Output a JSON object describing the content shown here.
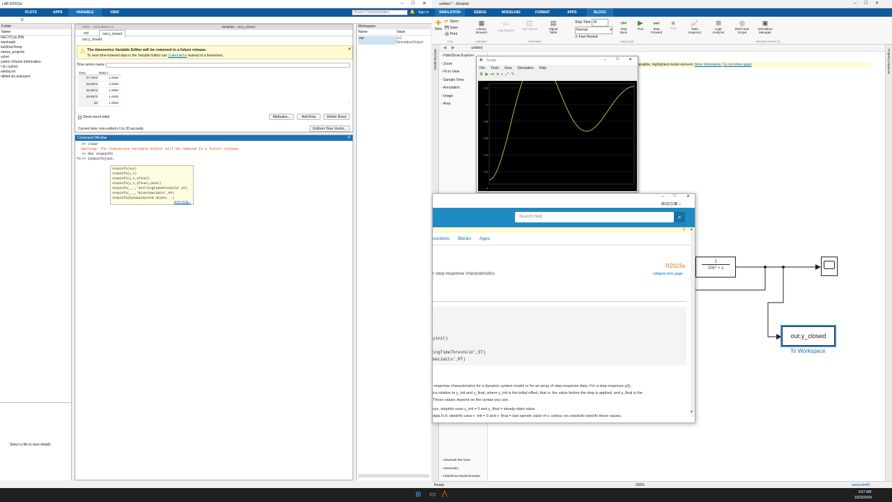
{
  "matlab": {
    "title": "LAB R2023a",
    "tabs": [
      "PLOTS",
      "APPS",
      "VARIABLE",
      "VIEW"
    ],
    "search_placeholder": "Search Documentation",
    "signin": "Sign In",
    "path": "D:",
    "folder_header": "Folder",
    "folder_col": "Name",
    "folder_items": [
      "RECYCLE.BIN",
      "ownloads",
      "ineDriveTemp",
      "eartus_projects",
      "ocket",
      "ystem Volume Information",
      "l (in cache)",
      "esktop.ini",
      "ntitled.slx.autosave"
    ],
    "details_text": "Select a file to view details",
    "editor_tab": "Editor - sdcaulfdetm.m",
    "variables_tab": "Variables - out.y_closed",
    "var_subtabs": [
      "out",
      "out.y_closed"
    ],
    "var_name": "out.y_closed",
    "warning_title": "The timeseries Variable Editor will be removed in a future release.",
    "warning_body_pre": "To view time-indexed data in the Variable Editor use",
    "warning_link": "timetable",
    "warning_body_post": "instead of a timeseries.",
    "ts_name_label": "Time series name:",
    "table_headers": [
      "Time",
      "Data:1"
    ],
    "table_rows": [
      [
        "27.7973",
        "1.0000"
      ],
      [
        "28.3973",
        "1.0000"
      ],
      [
        "28.9973",
        "1.0000"
      ],
      [
        "29.5973",
        "1.0000"
      ],
      [
        "30",
        "1.0000"
      ]
    ],
    "show_event_label": "Show event table",
    "btn_attributes": "Attributes...",
    "btn_add_row": "Add Row",
    "btn_delete_rows": "Delete Rows",
    "current_time": "Current time: non-uniform 0 to 30 seconds",
    "btn_uniform": "Uniform Time Vector...",
    "cmd_header": "Command Window",
    "cmd_lines": [
      ">> clear"
    ],
    "cmd_warning": "Warning: The timeseries Variable Editor will be removed in a future release",
    "cmd_doc": ">> doc stepinfo",
    "cmd_prompt": ">> stepinfo(out.",
    "autocomplete": [
      "stepinfo(sys)",
      "stepinfo(y,t)",
      "stepinfo(y,t,yfinal)",
      "stepinfo(y,t,yfinal,yinit)",
      "stepinfo(___,'SettlingTimeThreshold',ST)",
      "stepinfo(___,'RiseTimeLimits',RT)",
      "stepinfo(DynamicSystem object...)"
    ],
    "autocomplete_more": "More Help...",
    "workspace_header": "Workspace",
    "ws_cols": [
      "Name",
      "Value"
    ],
    "ws_name": "out",
    "ws_value": "1x1 SimulationOutput"
  },
  "simulink": {
    "title": "untitled * - Simulink",
    "tabs": [
      "SIMULATION",
      "DEBUG",
      "MODELING",
      "FORMAT",
      "APPS",
      "BLOCK"
    ],
    "file_items": [
      "Open",
      "Save",
      "Print"
    ],
    "new_label": "New",
    "library_label": "Library Browser",
    "prepare_items": [
      "Log Signals",
      "Add Viewer",
      "Signal Table"
    ],
    "stop_time_label": "Stop Time",
    "stop_time": "30",
    "mode": "Normal",
    "fast_restart": "Fast Restart",
    "sim_buttons": [
      "Step Back",
      "Run",
      "Step Forward",
      "Stop"
    ],
    "review_items": [
      "Data Inspector",
      "Logic Analyzer",
      "Bird's-Eye Scope",
      "Simulation Manager"
    ],
    "section_labels": [
      "FILE",
      "LIBRARY",
      "PREPARE",
      "SIMULATE",
      "REVIEW RESULTS"
    ],
    "model_name": "untitled",
    "left_tools": [
      "Hide/Show Explorer",
      "Zoom",
      "Fit to View",
      "Sample Time",
      "Annotation",
      "Image",
      "Area"
    ],
    "bottom_tools": [
      "Viewmark this View",
      "Viewmarks",
      "Hide/Show Model Browser"
    ],
    "notice": "mpatible, highlighted model element.",
    "notice_more": "More information.",
    "notice_dismiss": "Do not show again",
    "tf_num": "1",
    "tf_den": "10s² + s",
    "workspace_block": "out.y_closed",
    "workspace_block_label": "To Workspace",
    "status_left": "Ready",
    "status_zoom": "200%",
    "status_right": "auto(ode45)",
    "model_browser": "Model Browser",
    "property_inspector": "Property Inspector"
  },
  "scope": {
    "title": "Scope",
    "menu": [
      "File",
      "Tools",
      "View",
      "Simulation",
      "Help"
    ],
    "y_ticks": [
      "1.2",
      "1",
      "0.8",
      "0.6",
      "0.4",
      "0.2",
      "0"
    ]
  },
  "help": {
    "search_placeholder": "Search Help",
    "nav": [
      "unctions",
      "Blocks",
      "Apps"
    ],
    "release": "R2023a",
    "collapse": "collapse all in page",
    "subtitle": "r step-response characteristics",
    "code1": "yinit)",
    "code2": "ingTimeThreshold',ST)",
    "code3": "meLimits',RT)",
    "desc1": "-response characteristics for a dynamic system model or for an array of step-response data. For a step response y(t),",
    "desc2": "ics relative to y_init and y_final, where y_init is the initial offset, that is, the value before the step is applied, and y_final is the",
    "desc3": "These values depend on the syntax you use.",
    "desc4": "sys, stepinfo uses y_init = 0 and y_final = steady-state value",
    "desc5": "data [y,t], stepinfo uses y_init = 0 and y_final = last sample value of y, unless you explicitly specify these values."
  },
  "taskbar": {
    "time": "9:57 AM",
    "date": "10/25/2024"
  },
  "colors": {
    "matlab_blue": "#0e5a9b",
    "toolstrip_blue": "#1c6fb5",
    "help_blue": "#1e8bc3",
    "warning_yellow": "#fffbd0",
    "scope_bg": "#000000",
    "scope_line": "#e8e04a"
  }
}
